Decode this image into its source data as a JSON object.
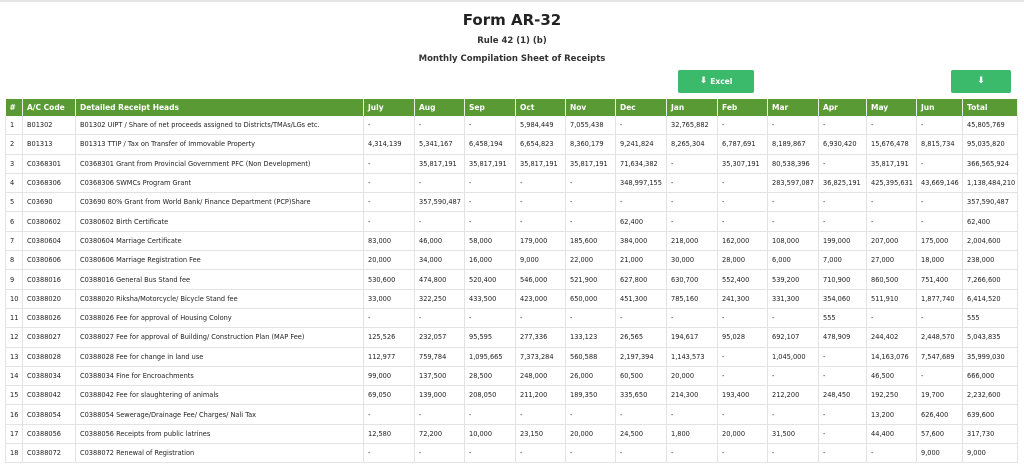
{
  "header": {
    "title": "Form AR-32",
    "rule": "Rule 42 (1) (b)",
    "subtitle": "Monthly Compilation Sheet of Receipts"
  },
  "buttons": {
    "excel_label": "Excel"
  },
  "colors": {
    "table_header_bg": "#5a9a35",
    "button_bg": "#3cba6b"
  },
  "table": {
    "columns": [
      "#",
      "A/C Code",
      "Detailed Receipt Heads",
      "July",
      "Aug",
      "Sep",
      "Oct",
      "Nov",
      "Dec",
      "Jan",
      "Feb",
      "Mar",
      "Apr",
      "May",
      "Jun",
      "Total"
    ],
    "rows": [
      [
        "1",
        "B01302",
        "B01302 UIPT / Share of net proceeds assigned to Districts/TMAs/LGs etc.",
        "-",
        "-",
        "-",
        "5,984,449",
        "7,055,438",
        "-",
        "32,765,882",
        "-",
        "-",
        "-",
        "-",
        "-",
        "45,805,769"
      ],
      [
        "2",
        "B01313",
        "B01313 TTIP / Tax on Transfer of Immovable Property",
        "4,314,139",
        "5,341,167",
        "6,458,194",
        "6,654,823",
        "8,360,179",
        "9,241,824",
        "8,265,304",
        "6,787,691",
        "8,189,867",
        "6,930,420",
        "15,676,478",
        "8,815,734",
        "95,035,820"
      ],
      [
        "3",
        "C0368301",
        "C0368301 Grant from Provincial Government PFC (Non Development)",
        "-",
        "35,817,191",
        "35,817,191",
        "35,817,191",
        "35,817,191",
        "71,634,382",
        "-",
        "35,307,191",
        "80,538,396",
        "-",
        "35,817,191",
        "-",
        "366,565,924"
      ],
      [
        "4",
        "C0368306",
        "C0368306 SWMCs Program Grant",
        "-",
        "-",
        "-",
        "-",
        "-",
        "348,997,155",
        "-",
        "-",
        "283,597,087",
        "36,825,191",
        "425,395,631",
        "43,669,146",
        "1,138,484,210"
      ],
      [
        "5",
        "C03690",
        "C03690 80% Grant from World Bank/ Finance Department (PCP)Share",
        "-",
        "357,590,487",
        "-",
        "-",
        "-",
        "-",
        "-",
        "-",
        "-",
        "-",
        "-",
        "-",
        "357,590,487"
      ],
      [
        "6",
        "C0380602",
        "C0380602 Birth Certificate",
        "-",
        "-",
        "-",
        "-",
        "-",
        "62,400",
        "-",
        "-",
        "-",
        "-",
        "-",
        "-",
        "62,400"
      ],
      [
        "7",
        "C0380604",
        "C0380604 Marriage Certificate",
        "83,000",
        "46,000",
        "58,000",
        "179,000",
        "185,600",
        "384,000",
        "218,000",
        "162,000",
        "108,000",
        "199,000",
        "207,000",
        "175,000",
        "2,004,600"
      ],
      [
        "8",
        "C0380606",
        "C0380606 Marriage Registration Fee",
        "20,000",
        "34,000",
        "16,000",
        "9,000",
        "22,000",
        "21,000",
        "30,000",
        "28,000",
        "6,000",
        "7,000",
        "27,000",
        "18,000",
        "238,000"
      ],
      [
        "9",
        "C0388016",
        "C0388016 General Bus Stand fee",
        "530,600",
        "474,800",
        "520,400",
        "546,000",
        "521,900",
        "627,800",
        "630,700",
        "552,400",
        "539,200",
        "710,900",
        "860,500",
        "751,400",
        "7,266,600"
      ],
      [
        "10",
        "C0388020",
        "C0388020 Riksha/Motorcycle/ Bicycle Stand fee",
        "33,000",
        "322,250",
        "433,500",
        "423,000",
        "650,000",
        "451,300",
        "785,160",
        "241,300",
        "331,300",
        "354,060",
        "511,910",
        "1,877,740",
        "6,414,520"
      ],
      [
        "11",
        "C0388026",
        "C0388026 Fee for approval of Housing Colony",
        "-",
        "-",
        "-",
        "-",
        "-",
        "-",
        "-",
        "-",
        "-",
        "555",
        "-",
        "-",
        "555"
      ],
      [
        "12",
        "C0388027",
        "C0388027 Fee for approval of Building/ Construction Plan (MAP Fee)",
        "125,526",
        "232,057",
        "95,595",
        "277,336",
        "133,123",
        "26,565",
        "194,617",
        "95,028",
        "692,107",
        "478,909",
        "244,402",
        "2,448,570",
        "5,043,835"
      ],
      [
        "13",
        "C0388028",
        "C0388028 Fee for change in land use",
        "112,977",
        "759,784",
        "1,095,665",
        "7,373,284",
        "560,588",
        "2,197,394",
        "1,143,573",
        "-",
        "1,045,000",
        "-",
        "14,163,076",
        "7,547,689",
        "35,999,030"
      ],
      [
        "14",
        "C0388034",
        "C0388034 Fine for Encroachments",
        "99,000",
        "137,500",
        "28,500",
        "248,000",
        "26,000",
        "60,500",
        "20,000",
        "-",
        "-",
        "-",
        "46,500",
        "-",
        "666,000"
      ],
      [
        "15",
        "C0388042",
        "C0388042 Fee for slaughtering of animals",
        "69,050",
        "139,000",
        "208,050",
        "211,200",
        "189,350",
        "335,650",
        "214,300",
        "193,400",
        "212,200",
        "248,450",
        "192,250",
        "19,700",
        "2,232,600"
      ],
      [
        "16",
        "C0388054",
        "C0388054 Sewerage/Drainage Fee/ Charges/ Nali Tax",
        "-",
        "-",
        "-",
        "-",
        "-",
        "-",
        "-",
        "-",
        "-",
        "-",
        "13,200",
        "626,400",
        "639,600"
      ],
      [
        "17",
        "C0388056",
        "C0388056 Receipts from public latrines",
        "12,580",
        "72,200",
        "10,000",
        "23,150",
        "20,000",
        "24,500",
        "1,800",
        "20,000",
        "31,500",
        "-",
        "44,400",
        "57,600",
        "317,730"
      ],
      [
        "18",
        "C0388072",
        "C0388072 Renewal of Registration",
        "-",
        "-",
        "-",
        "-",
        "-",
        "-",
        "-",
        "-",
        "-",
        "-",
        "-",
        "9,000",
        "9,000"
      ]
    ]
  }
}
